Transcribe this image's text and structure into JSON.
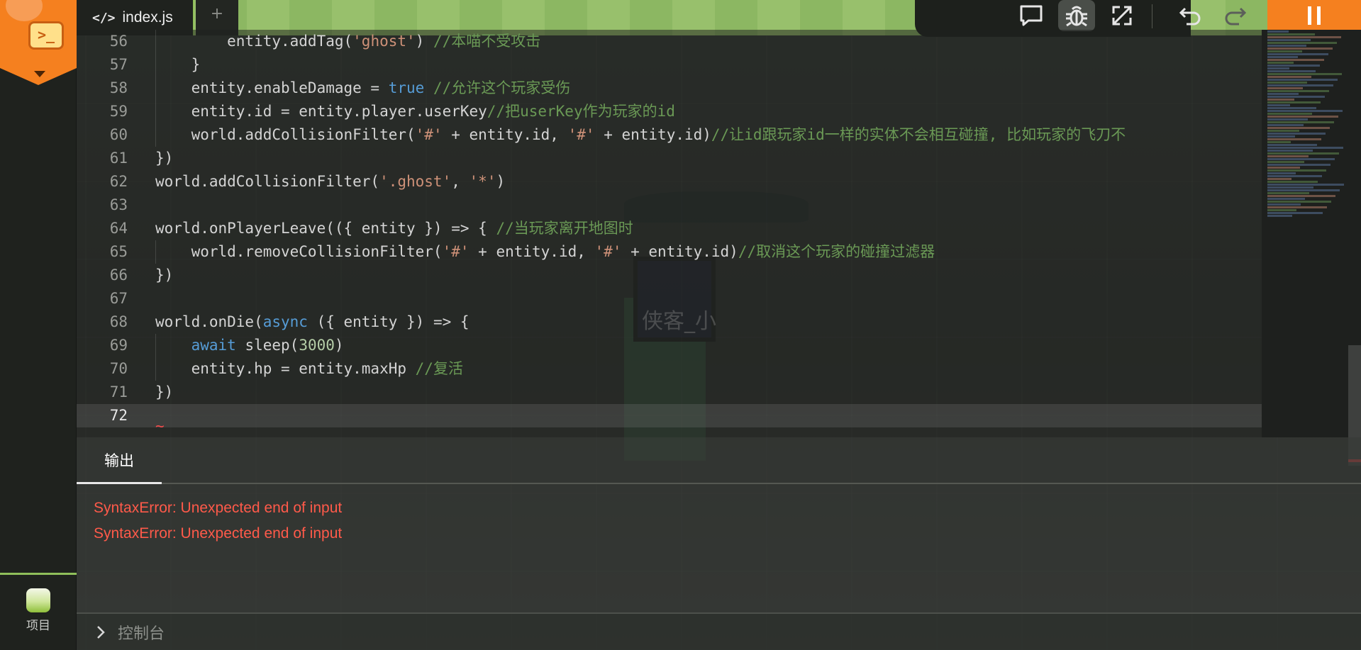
{
  "app": {
    "logo_icon": "terminal-icon",
    "accent_color": "#f5801f"
  },
  "tabs": {
    "file_name": "index.js",
    "add_label": "+"
  },
  "toolbar": {
    "icons": [
      "comment-icon",
      "bug-icon",
      "expand-icon",
      "undo-icon",
      "redo-icon",
      "pause-icon"
    ]
  },
  "editor": {
    "lines": [
      {
        "num": "56",
        "text": "        entity.addTag('ghost') //本喵不受攻击"
      },
      {
        "num": "57",
        "text": "    }"
      },
      {
        "num": "58",
        "text": "    entity.enableDamage = true //允许这个玩家受伤"
      },
      {
        "num": "59",
        "text": "    entity.id = entity.player.userKey//把userKey作为玩家的id"
      },
      {
        "num": "60",
        "text": "    world.addCollisionFilter('#' + entity.id, '#' + entity.id)//让id跟玩家id一样的实体不会相互碰撞, 比如玩家的飞刀不"
      },
      {
        "num": "61",
        "text": "})"
      },
      {
        "num": "62",
        "text": "world.addCollisionFilter('.ghost', '*')"
      },
      {
        "num": "63",
        "text": ""
      },
      {
        "num": "64",
        "text": "world.onPlayerLeave(({ entity }) => { //当玩家离开地图时"
      },
      {
        "num": "65",
        "text": "    world.removeCollisionFilter('#' + entity.id, '#' + entity.id)//取消这个玩家的碰撞过滤器"
      },
      {
        "num": "66",
        "text": "})"
      },
      {
        "num": "67",
        "text": ""
      },
      {
        "num": "68",
        "text": "world.onDie(async ({ entity }) => {"
      },
      {
        "num": "69",
        "text": "    await sleep(3000)"
      },
      {
        "num": "70",
        "text": "    entity.hp = entity.maxHp //复活"
      },
      {
        "num": "71",
        "text": "})"
      },
      {
        "num": "72",
        "text": ""
      }
    ],
    "error_marker": "~"
  },
  "game": {
    "player_name": "侠客_小"
  },
  "output": {
    "tab_label": "输出",
    "errors": [
      "SyntaxError: Unexpected end of input",
      "SyntaxError: Unexpected end of input"
    ],
    "error_color": "#ff5a4a"
  },
  "console": {
    "label": "控制台"
  },
  "sidebar": {
    "project_label": "项目"
  }
}
